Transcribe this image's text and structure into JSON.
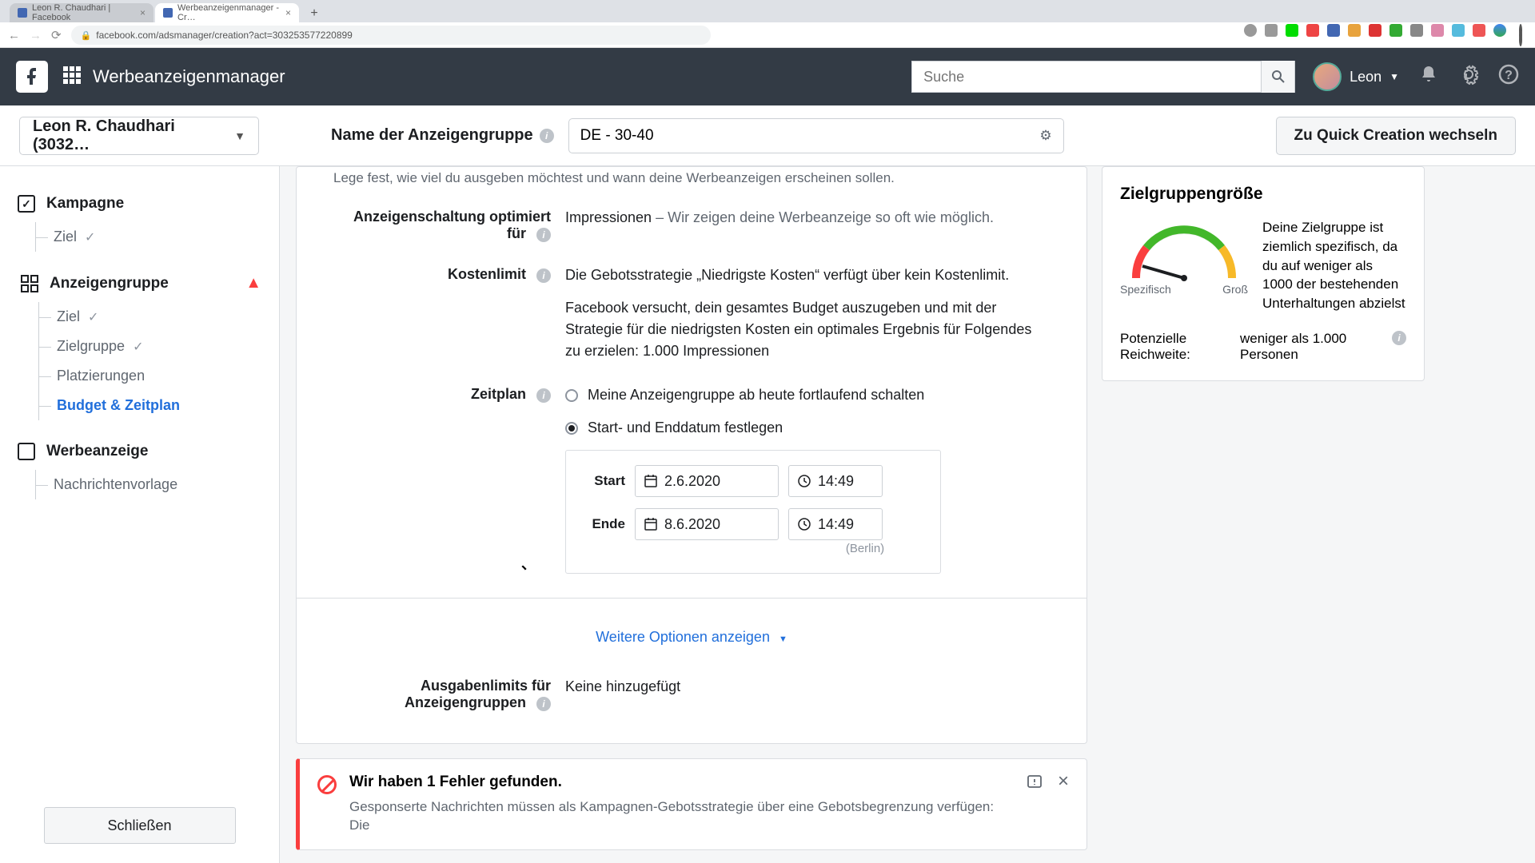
{
  "browser": {
    "tabs": [
      {
        "title": "Leon R. Chaudhari | Facebook"
      },
      {
        "title": "Werbeanzeigenmanager - Cr…"
      }
    ],
    "url": "facebook.com/adsmanager/creation?act=303253577220899"
  },
  "header": {
    "app_name": "Werbeanzeigenmanager",
    "search_placeholder": "Suche",
    "user_name": "Leon"
  },
  "subheader": {
    "account": "Leon R. Chaudhari (3032…",
    "name_label": "Name der Anzeigengruppe",
    "name_value": "DE - 30-40",
    "quick_btn": "Zu Quick Creation wechseln"
  },
  "sidebar": {
    "campaign": {
      "label": "Kampagne",
      "items": [
        {
          "label": "Ziel"
        }
      ]
    },
    "adset": {
      "label": "Anzeigengruppe",
      "items": [
        {
          "label": "Ziel"
        },
        {
          "label": "Zielgruppe"
        },
        {
          "label": "Platzierungen"
        },
        {
          "label": "Budget & Zeitplan"
        }
      ]
    },
    "ad": {
      "label": "Werbeanzeige",
      "items": [
        {
          "label": "Nachrichtenvorlage"
        }
      ]
    },
    "close_btn": "Schließen"
  },
  "form": {
    "description": "Lege fest, wie viel du ausgeben möchtest und wann deine Werbeanzeigen erscheinen sollen.",
    "optimize": {
      "label": "Anzeigenschaltung optimiert für",
      "value": "Impressionen",
      "desc": " – Wir zeigen deine Werbeanzeige so oft wie möglich."
    },
    "cost": {
      "label": "Kostenlimit",
      "line1": "Die Gebotsstrategie „Niedrigste Kosten“ verfügt über kein Kostenlimit.",
      "line2": "Facebook versucht, dein gesamtes Budget auszugeben und mit der Strategie für die niedrigsten Kosten ein optimales Ergebnis für Folgendes zu erzielen: 1.000 Impressionen"
    },
    "schedule": {
      "label": "Zeitplan",
      "opt1": "Meine Anzeigengruppe ab heute fortlaufend schalten",
      "opt2": "Start- und Enddatum festlegen",
      "start_lbl": "Start",
      "end_lbl": "Ende",
      "start_date": "2.6.2020",
      "start_time": "14:49",
      "end_date": "8.6.2020",
      "end_time": "14:49",
      "tz": "(Berlin)"
    },
    "more_link": "Weitere Optionen anzeigen",
    "spend_limit": {
      "label": "Ausgabenlimits für Anzeigengruppen",
      "value": "Keine hinzugefügt"
    }
  },
  "error": {
    "title": "Wir haben 1 Fehler gefunden.",
    "desc": "Gesponserte Nachrichten müssen als Kampagnen-Gebotsstrategie über eine Gebotsbegrenzung verfügen: Die"
  },
  "audience": {
    "title": "Zielgruppengröße",
    "left": "Spezifisch",
    "right": "Groß",
    "desc": "Deine Zielgruppe ist ziemlich spezifisch, da du auf weniger als 1000 der bestehenden Unterhaltungen abzielst",
    "reach_lbl": "Potenzielle Reichweite:",
    "reach_val": "weniger als 1.000 Personen"
  }
}
